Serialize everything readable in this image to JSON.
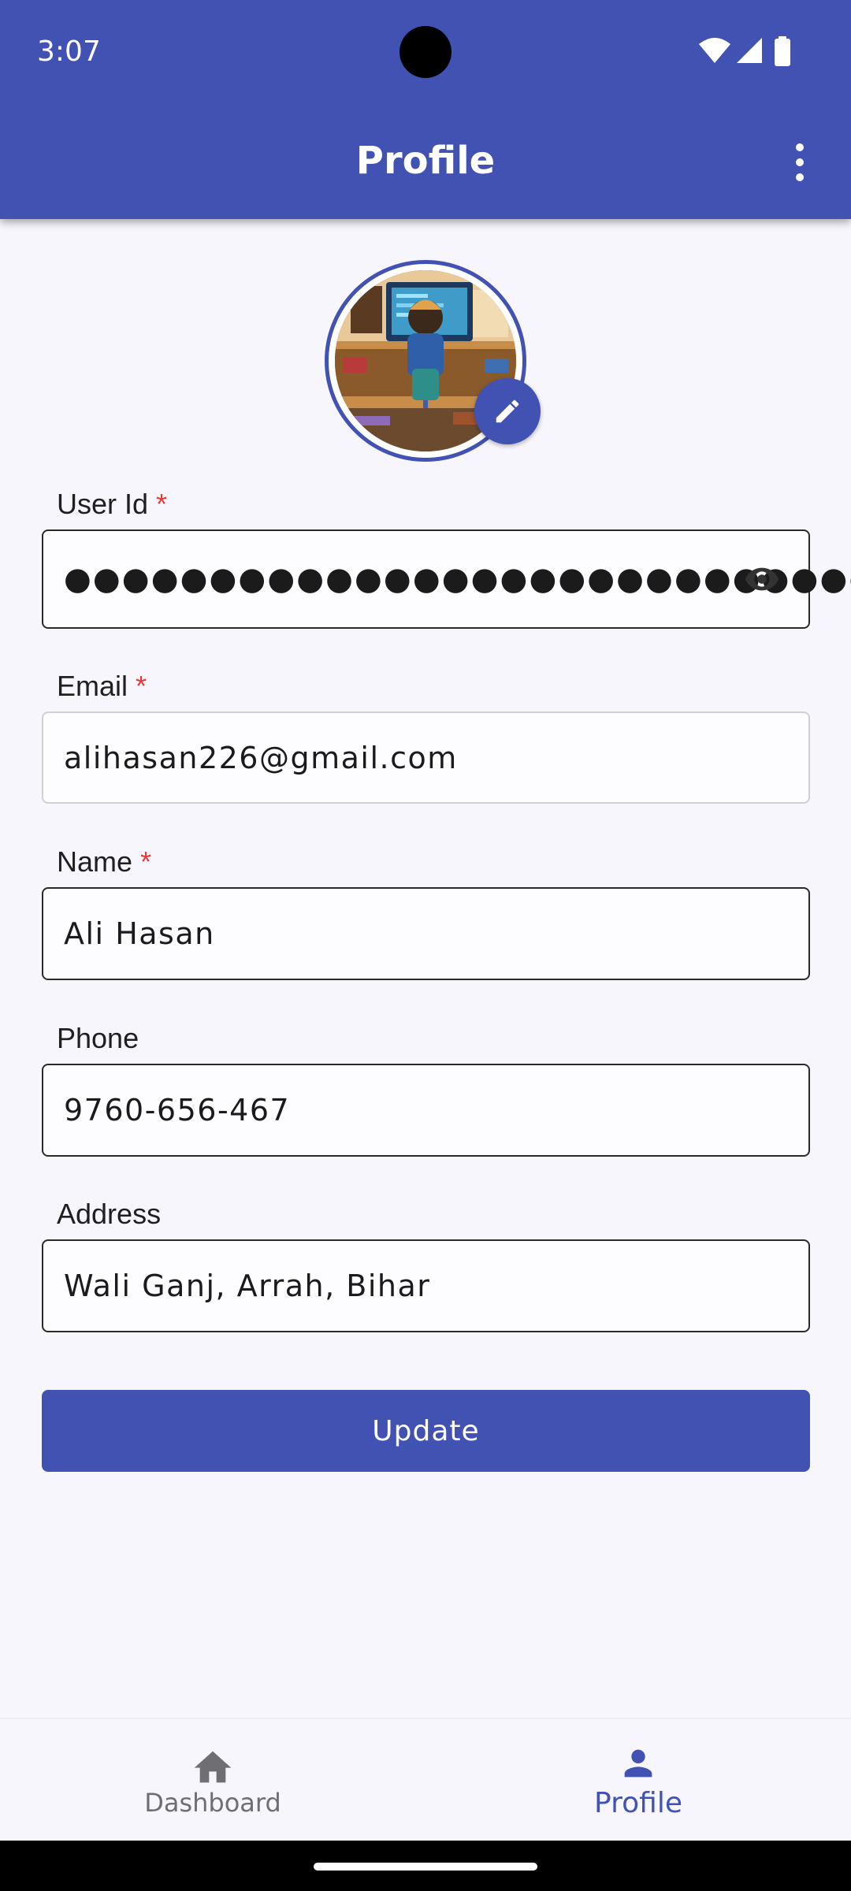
{
  "status_bar": {
    "time": "3:07"
  },
  "app_bar": {
    "title": "Profile"
  },
  "profile_avatar": {
    "alt": "Profile picture: child at a desk with computer"
  },
  "fields": {
    "user_id": {
      "label": "User Id",
      "required_mark": "*",
      "value": "●●●●●●●●●●●●●●●●●●●●●●●●●●●●"
    },
    "email": {
      "label": "Email",
      "required_mark": "*",
      "value": "alihasan226@gmail.com"
    },
    "name": {
      "label": "Name",
      "required_mark": "*",
      "value": "Ali Hasan"
    },
    "phone": {
      "label": "Phone",
      "value": "9760-656-467"
    },
    "address": {
      "label": "Address",
      "value": "Wali Ganj, Arrah, Bihar"
    }
  },
  "update_label": "Update",
  "bottom_nav": {
    "items": [
      {
        "label": "Dashboard",
        "icon": "home-icon",
        "active": false
      },
      {
        "label": "Profile",
        "icon": "person-icon",
        "active": true
      }
    ]
  },
  "colors": {
    "primary": "#4152b3",
    "required": "#e53935",
    "background": "#f8f6fd"
  }
}
